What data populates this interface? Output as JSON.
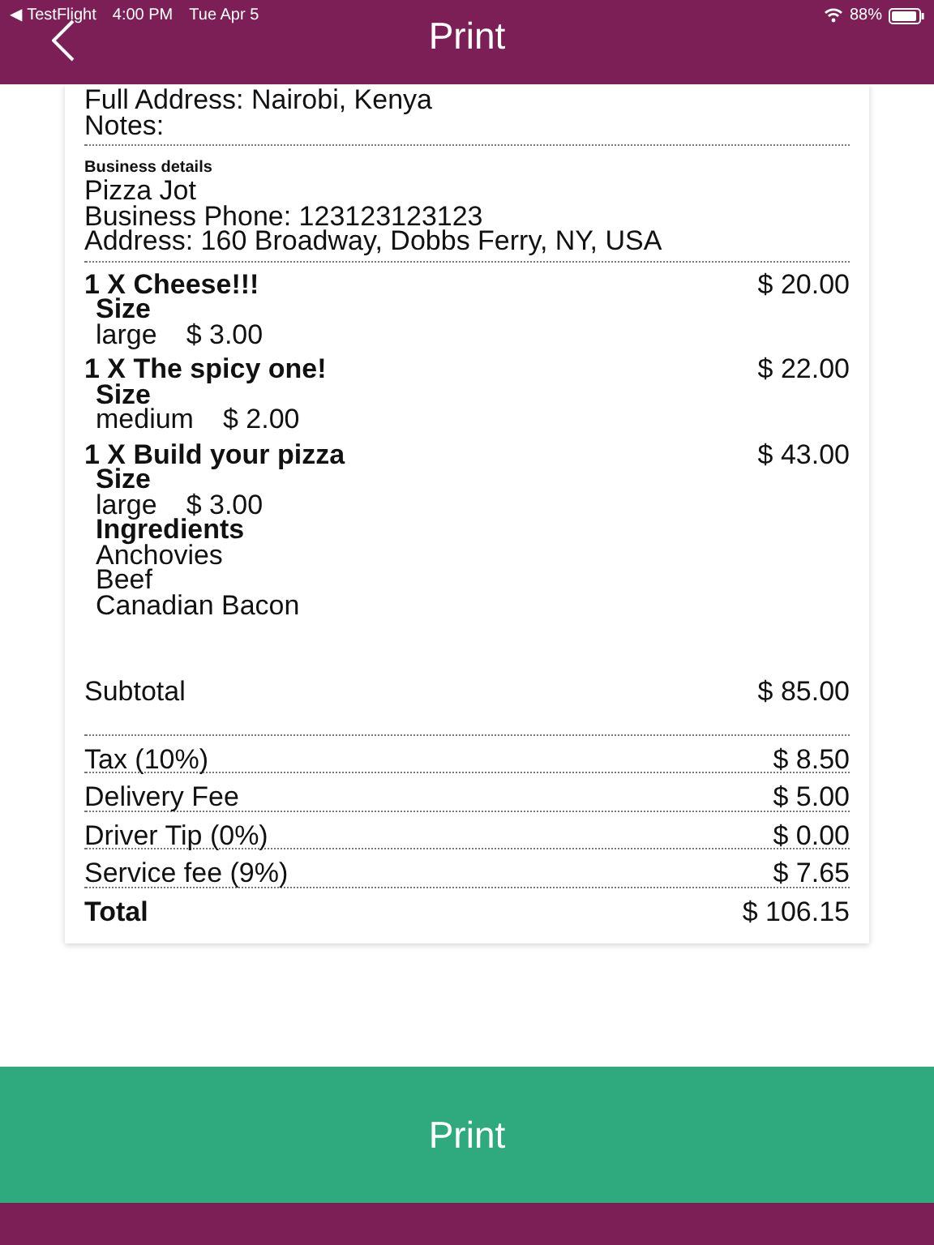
{
  "status_bar": {
    "back_app": "◀ TestFlight",
    "time": "4:00 PM",
    "date": "Tue Apr 5",
    "battery": "88%"
  },
  "header": {
    "title": "Print"
  },
  "customer_lines": [
    "Full Address: Nairobi, Kenya",
    "Notes:"
  ],
  "business": {
    "heading": "Business details",
    "lines": [
      "Pizza Jot",
      "Business Phone: 123123123123",
      "Address: 160 Broadway, Dobbs Ferry, NY, USA"
    ]
  },
  "items": [
    {
      "title": "1 X Cheese!!!",
      "price": "$ 20.00",
      "options": [
        {
          "group": "Size",
          "values": [
            {
              "name": "large",
              "price": "$ 3.00"
            }
          ]
        }
      ]
    },
    {
      "title": "1 X The spicy one!",
      "price": "$ 22.00",
      "options": [
        {
          "group": "Size",
          "values": [
            {
              "name": "medium",
              "price": "$ 2.00"
            }
          ]
        }
      ]
    },
    {
      "title": "1 X Build your pizza",
      "price": "$ 43.00",
      "options": [
        {
          "group": "Size",
          "values": [
            {
              "name": "large",
              "price": "$ 3.00"
            }
          ]
        },
        {
          "group": "Ingredients",
          "values": [
            {
              "name": "Anchovies"
            },
            {
              "name": "Beef"
            },
            {
              "name": "Canadian Bacon"
            }
          ]
        }
      ]
    }
  ],
  "subtotal": {
    "label": "Subtotal",
    "value": "$ 85.00"
  },
  "charges": [
    {
      "label": "Tax (10%)",
      "value": "$ 8.50"
    },
    {
      "label": "Delivery Fee",
      "value": "$ 5.00"
    },
    {
      "label": "Driver Tip (0%)",
      "value": "$ 0.00"
    },
    {
      "label": "Service fee (9%)",
      "value": "$ 7.65"
    }
  ],
  "total": {
    "label": "Total",
    "value": "$ 106.15"
  },
  "print_button": "Print"
}
